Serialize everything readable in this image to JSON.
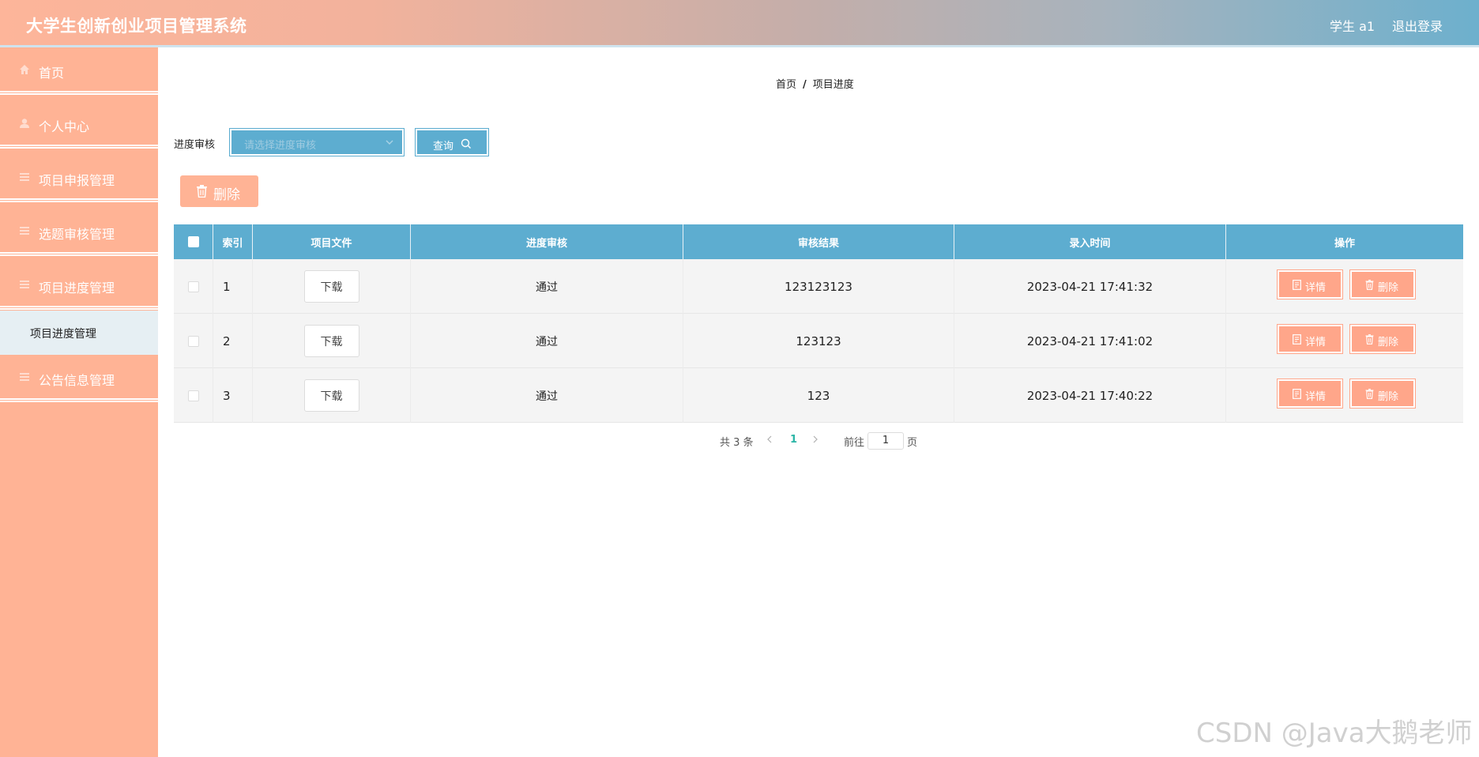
{
  "header": {
    "title": "大学生创新创业项目管理系统",
    "user": "学生 a1",
    "logout": "退出登录"
  },
  "sidebar": {
    "items": [
      {
        "label": "首页",
        "icon": "home-icon"
      },
      {
        "label": "个人中心",
        "icon": "user-icon"
      },
      {
        "label": "项目申报管理",
        "icon": "list-icon"
      },
      {
        "label": "选题审核管理",
        "icon": "list-icon"
      },
      {
        "label": "项目进度管理",
        "icon": "list-icon"
      },
      {
        "label": "公告信息管理",
        "icon": "list-icon"
      }
    ],
    "submenu": {
      "label": "项目进度管理"
    }
  },
  "breadcrumb": {
    "home": "首页",
    "sep": "/",
    "current": "项目进度"
  },
  "filter": {
    "label": "进度审核",
    "placeholder": "请选择进度审核",
    "query_label": "查询"
  },
  "toolbar": {
    "delete_label": "删除"
  },
  "table": {
    "columns": [
      "索引",
      "项目文件",
      "进度审核",
      "审核结果",
      "录入时间",
      "操作"
    ],
    "download_label": "下载",
    "detail_label": "详情",
    "delete_label": "删除",
    "rows": [
      {
        "index": "1",
        "status": "通过",
        "result": "123123123",
        "time": "2023-04-21 17:41:32"
      },
      {
        "index": "2",
        "status": "通过",
        "result": "123123",
        "time": "2023-04-21 17:41:02"
      },
      {
        "index": "3",
        "status": "通过",
        "result": "123",
        "time": "2023-04-21 17:40:22"
      }
    ]
  },
  "pagination": {
    "total": "共 3 条",
    "current": "1",
    "goto_label": "前往",
    "goto_value": "1",
    "page_unit": "页"
  },
  "watermark": "CSDN @Java大鹅老师",
  "colors": {
    "accent_blue": "#5dadd0",
    "accent_salmon": "#ffb395",
    "active_page": "#2bb5a6"
  }
}
